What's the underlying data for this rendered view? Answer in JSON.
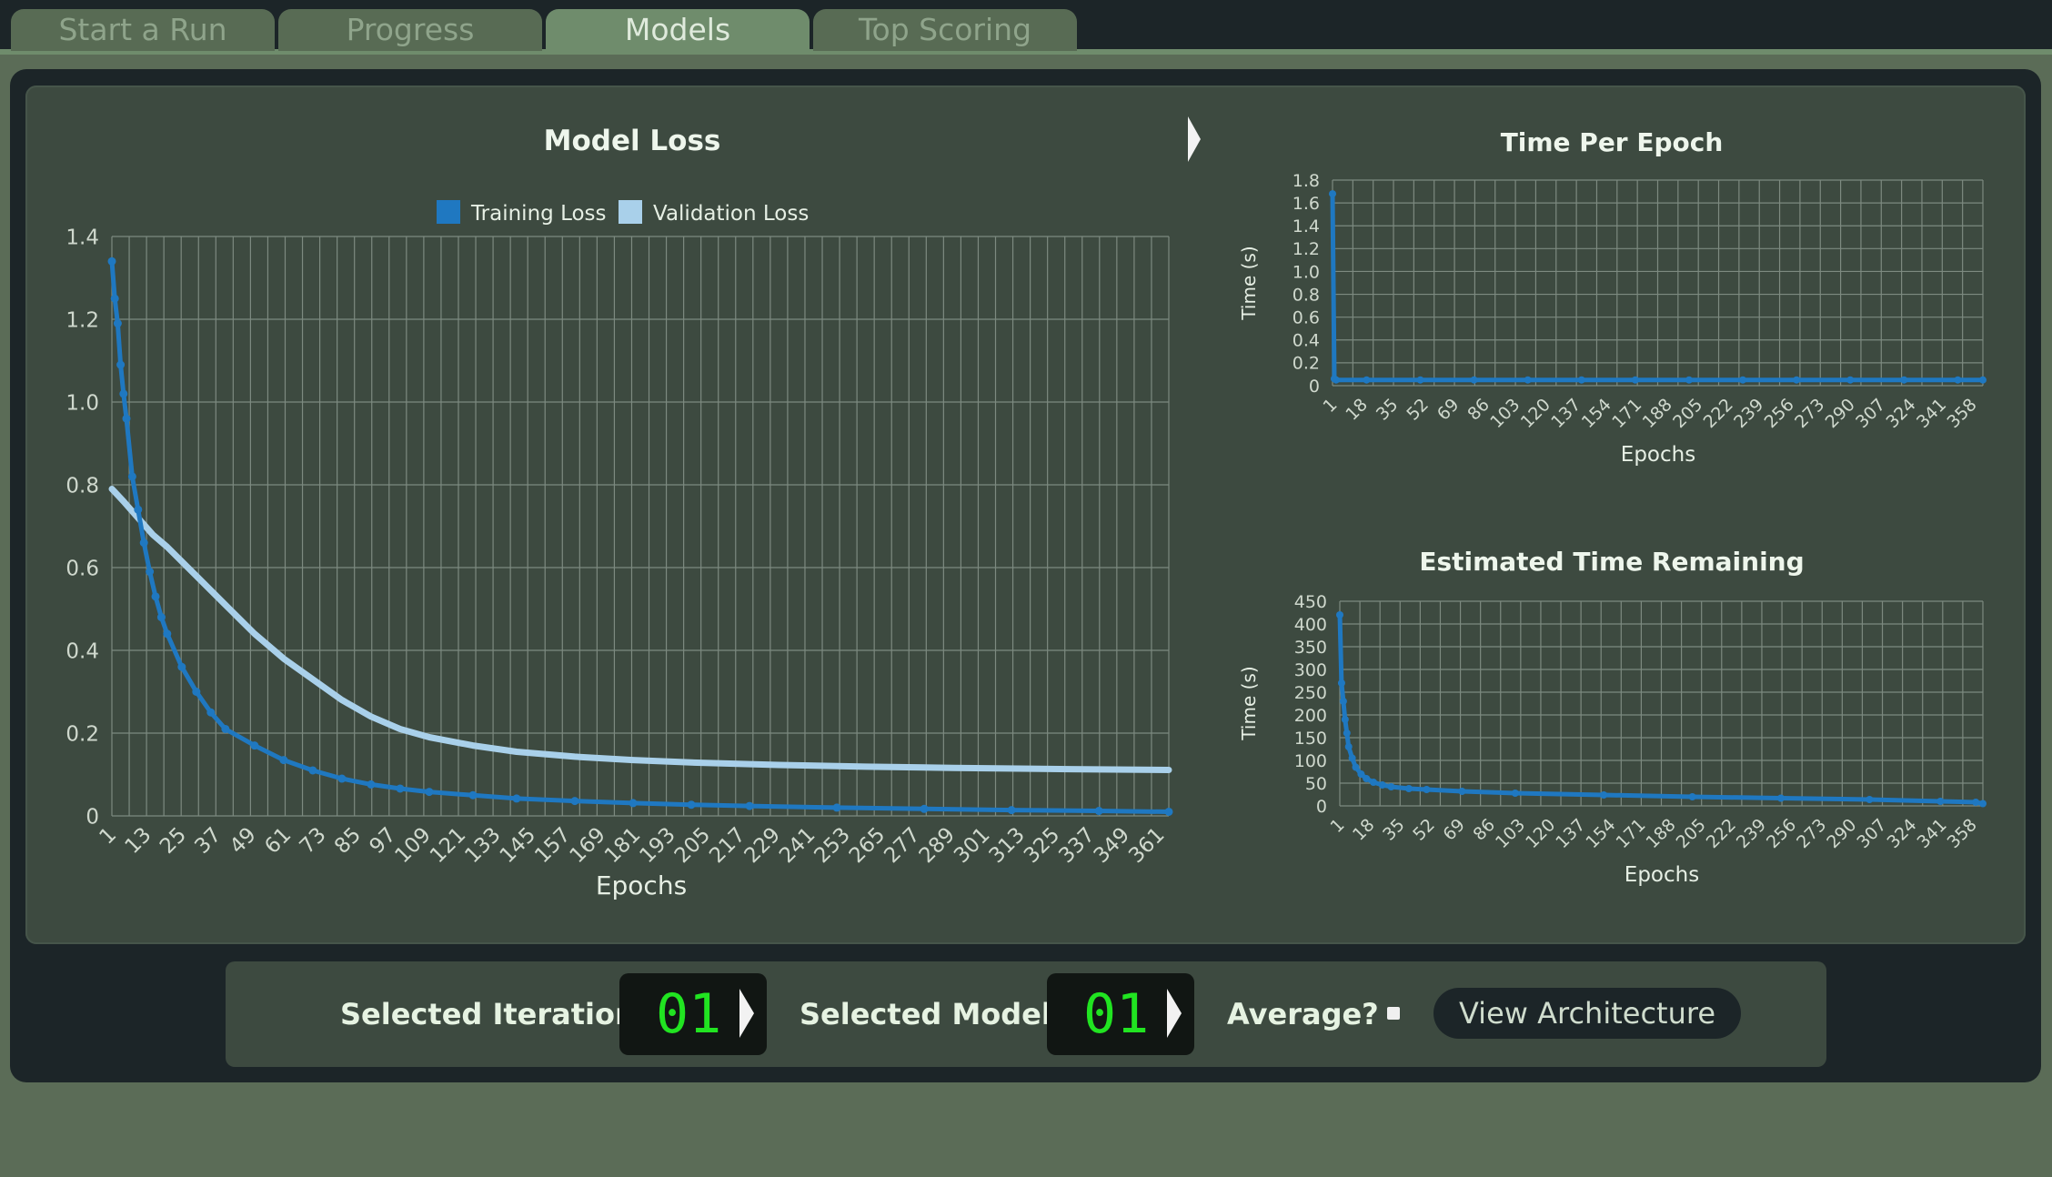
{
  "tabs": [
    {
      "label": "Start a Run",
      "active": false
    },
    {
      "label": "Progress",
      "active": false
    },
    {
      "label": "Models",
      "active": true
    },
    {
      "label": "Top Scoring",
      "active": false
    }
  ],
  "controls": {
    "iteration_label": "Selected Iteration",
    "iteration_value": "01",
    "model_label": "Selected Model",
    "model_value": "01",
    "average_label": "Average?",
    "average_checked": false,
    "view_button": "View Architecture"
  },
  "colors": {
    "training": "#1f78c1",
    "validation": "#a9d0ea",
    "panel": "#3d4a40",
    "digits": "#21e421"
  },
  "chart_data": [
    {
      "type": "line",
      "title": "Model Loss",
      "xlabel": "Epochs",
      "ylabel": "",
      "x_ticks": [
        "1",
        "13",
        "25",
        "37",
        "49",
        "61",
        "73",
        "85",
        "97",
        "109",
        "121",
        "133",
        "145",
        "157",
        "169",
        "181",
        "193",
        "205",
        "217",
        "229",
        "241",
        "253",
        "265",
        "277",
        "289",
        "301",
        "313",
        "325",
        "337",
        "349",
        "361"
      ],
      "y_ticks": [
        "0",
        "0.2",
        "0.4",
        "0.6",
        "0.8",
        "1.0",
        "1.2",
        "1.4"
      ],
      "xlim": [
        1,
        364
      ],
      "ylim": [
        0,
        1.4
      ],
      "grid": true,
      "legend": "top",
      "series": [
        {
          "name": "Training Loss",
          "x": [
            1,
            2,
            3,
            4,
            5,
            6,
            8,
            10,
            12,
            14,
            16,
            18,
            20,
            25,
            30,
            35,
            40,
            50,
            60,
            70,
            80,
            90,
            100,
            110,
            125,
            140,
            160,
            180,
            200,
            220,
            250,
            280,
            310,
            340,
            364
          ],
          "y": [
            1.34,
            1.25,
            1.19,
            1.09,
            1.02,
            0.96,
            0.82,
            0.74,
            0.66,
            0.59,
            0.53,
            0.48,
            0.44,
            0.36,
            0.3,
            0.25,
            0.21,
            0.17,
            0.135,
            0.11,
            0.09,
            0.076,
            0.066,
            0.058,
            0.05,
            0.042,
            0.036,
            0.031,
            0.027,
            0.024,
            0.02,
            0.017,
            0.014,
            0.012,
            0.01
          ]
        },
        {
          "name": "Validation Loss",
          "x": [
            1,
            5,
            10,
            15,
            20,
            30,
            40,
            50,
            60,
            70,
            80,
            90,
            100,
            110,
            125,
            140,
            160,
            180,
            200,
            230,
            260,
            290,
            330,
            364
          ],
          "y": [
            0.79,
            0.76,
            0.72,
            0.68,
            0.65,
            0.58,
            0.51,
            0.44,
            0.38,
            0.33,
            0.28,
            0.24,
            0.21,
            0.19,
            0.17,
            0.155,
            0.143,
            0.135,
            0.129,
            0.123,
            0.119,
            0.116,
            0.113,
            0.111
          ]
        }
      ]
    },
    {
      "type": "line",
      "title": "Time Per Epoch",
      "xlabel": "Epochs",
      "ylabel": "Time (s)",
      "x_ticks": [
        "1",
        "18",
        "35",
        "52",
        "69",
        "86",
        "103",
        "120",
        "137",
        "154",
        "171",
        "188",
        "205",
        "222",
        "239",
        "256",
        "273",
        "290",
        "307",
        "324",
        "341",
        "358"
      ],
      "y_ticks": [
        "0",
        "0.2",
        "0.4",
        "0.6",
        "0.8",
        "1.0",
        "1.2",
        "1.4",
        "1.6",
        "1.8"
      ],
      "xlim": [
        1,
        364
      ],
      "ylim": [
        0,
        1.8
      ],
      "grid": true,
      "series": [
        {
          "name": "",
          "x": [
            1,
            2,
            3,
            20,
            50,
            80,
            110,
            140,
            170,
            200,
            230,
            260,
            290,
            320,
            350,
            364
          ],
          "y": [
            1.68,
            0.06,
            0.05,
            0.05,
            0.05,
            0.05,
            0.05,
            0.05,
            0.05,
            0.05,
            0.05,
            0.05,
            0.05,
            0.05,
            0.05,
            0.05
          ]
        }
      ]
    },
    {
      "type": "line",
      "title": "Estimated Time Remaining",
      "xlabel": "Epochs",
      "ylabel": "Time (s)",
      "x_ticks": [
        "1",
        "18",
        "35",
        "52",
        "69",
        "86",
        "103",
        "120",
        "137",
        "154",
        "171",
        "188",
        "205",
        "222",
        "239",
        "256",
        "273",
        "290",
        "307",
        "324",
        "341",
        "358"
      ],
      "y_ticks": [
        "0",
        "50",
        "100",
        "150",
        "200",
        "250",
        "300",
        "350",
        "400",
        "450"
      ],
      "xlim": [
        1,
        364
      ],
      "ylim": [
        0,
        450
      ],
      "grid": true,
      "series": [
        {
          "name": "",
          "x": [
            1,
            2,
            3,
            4,
            5,
            6,
            8,
            10,
            13,
            16,
            20,
            25,
            30,
            40,
            50,
            70,
            100,
            150,
            200,
            250,
            300,
            340,
            360,
            364
          ],
          "y": [
            420,
            270,
            230,
            190,
            160,
            130,
            105,
            85,
            70,
            60,
            52,
            46,
            42,
            38,
            36,
            32,
            28,
            24,
            20,
            17,
            14,
            10,
            8,
            5
          ]
        }
      ]
    }
  ]
}
